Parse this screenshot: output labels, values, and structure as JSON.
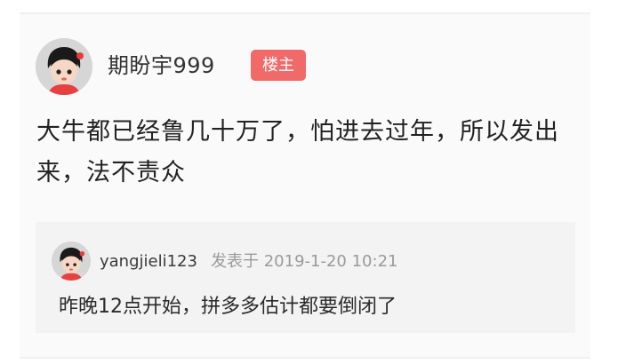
{
  "post": {
    "username": "期盼宇999",
    "badge": "楼主",
    "avatar": "cartoon-girl-avatar",
    "text": "大牛都已经鲁几十万了，怕进去过年，所以发出来，法不责众"
  },
  "reply": {
    "username": "yangjieli123",
    "meta": "发表于 2019-1-20 10:21",
    "avatar": "cartoon-girl-avatar",
    "text": "昨晚12点开始，拼多多估计都要倒闭了"
  },
  "colors": {
    "badge_bg": "#f16a6a",
    "card_bg": "#fafafa",
    "reply_bg": "#f3f3f3",
    "meta_text": "#9a9a9a"
  }
}
